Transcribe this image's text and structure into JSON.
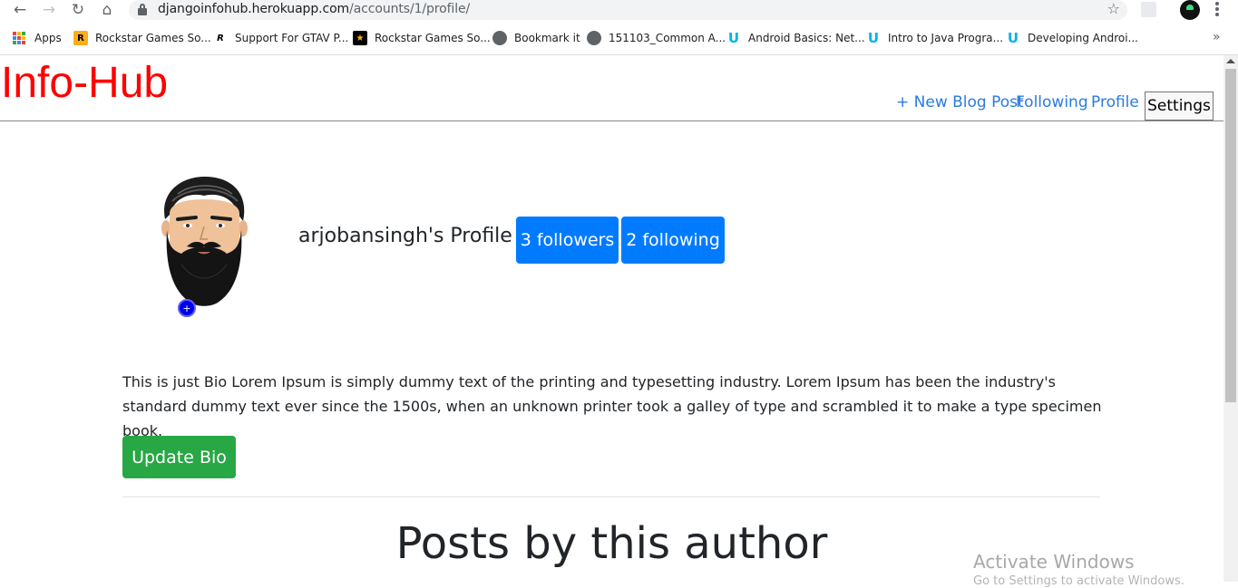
{
  "browser": {
    "url_host": "djangoinfohub.herokuapp.com",
    "url_path": "/accounts/1/profile/",
    "bookmarks": [
      {
        "label": "Apps",
        "icon": "apps-grid-icon"
      },
      {
        "label": "Rockstar Games So...",
        "icon": "rockstar-icon",
        "color": "#fcaf17"
      },
      {
        "label": "Support For GTAV P...",
        "icon": "rockstar-r-icon"
      },
      {
        "label": "Rockstar Games So...",
        "icon": "star-icon",
        "color": "#000000"
      },
      {
        "label": "Bookmark it",
        "icon": "globe-icon"
      },
      {
        "label": "151103_Common A...",
        "icon": "globe-icon"
      },
      {
        "label": "Android Basics: Net...",
        "icon": "udacity-icon",
        "color": "#02b3e4"
      },
      {
        "label": "Intro to Java Progra...",
        "icon": "udacity-icon",
        "color": "#02b3e4"
      },
      {
        "label": "Developing Androi...",
        "icon": "udacity-icon",
        "color": "#02b3e4"
      }
    ],
    "more_label": "»"
  },
  "site": {
    "title": "Info-Hub",
    "title_color": "#ff0000",
    "nav": {
      "new_post": "+ New Blog Post",
      "following": "Following",
      "profile": "Profile",
      "settings": "Settings"
    }
  },
  "profile": {
    "name_heading": "arjobansingh's Profile",
    "followers": "3 followers",
    "following": "2 following",
    "avatar_add": "+",
    "bio": "This is just Bio Lorem Ipsum is simply dummy text of the printing and typesetting industry. Lorem Ipsum has been the industry's standard dummy text ever since the 1500s, when an unknown printer took a galley of type and scrambled it to make a type specimen book.",
    "update_bio": "Update Bio"
  },
  "posts": {
    "heading": "Posts by this author"
  },
  "overlay": {
    "activate": "Activate Windows",
    "activate_sub": "Go to Settings to activate Windows."
  },
  "colors": {
    "primary": "#007bff",
    "success": "#28a745",
    "link": "#2a7ae2"
  }
}
